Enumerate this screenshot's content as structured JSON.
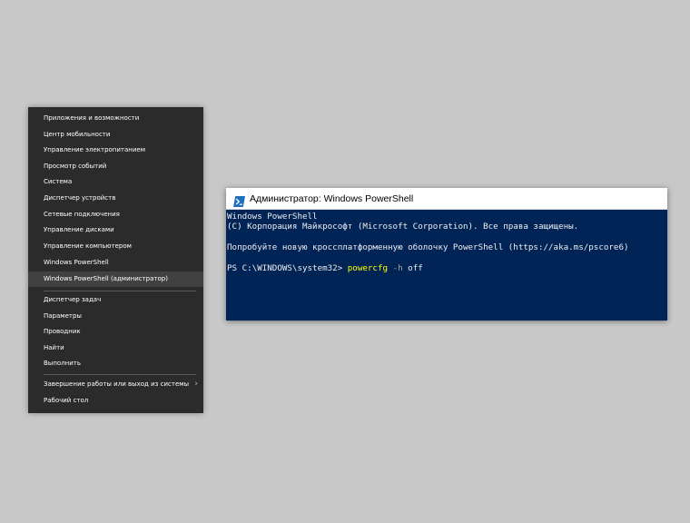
{
  "winx_menu": {
    "items": [
      "Приложения и возможности",
      "Центр мобильности",
      "Управление электропитанием",
      "Просмотр событий",
      "Система",
      "Диспетчер устройств",
      "Сетевые подключения",
      "Управление дисками",
      "Управление компьютером",
      "Windows PowerShell",
      "Windows PowerShell (администратор)",
      "Диспетчер задач",
      "Параметры",
      "Проводник",
      "Найти",
      "Выполнить",
      "Завершение работы или выход из системы",
      "Рабочий стол"
    ],
    "selected_index": 10,
    "submenu_arrow": "›"
  },
  "powershell": {
    "title": "Администратор: Windows PowerShell",
    "lines": [
      "Windows PowerShell",
      "(C) Корпорация Майкрософт (Microsoft Corporation). Все права защищены.",
      "",
      "Попробуйте новую кроссплатформенную оболочку PowerShell (https://aka.ms/pscore6)",
      ""
    ],
    "prompt": "PS C:\\WINDOWS\\system32> ",
    "command": "powercfg",
    "parameter": " -h",
    "argument": " off",
    "colors": {
      "background": "#012456",
      "text": "#eeedf0",
      "command": "#ffff00",
      "parameter": "#a0a0a0"
    }
  }
}
